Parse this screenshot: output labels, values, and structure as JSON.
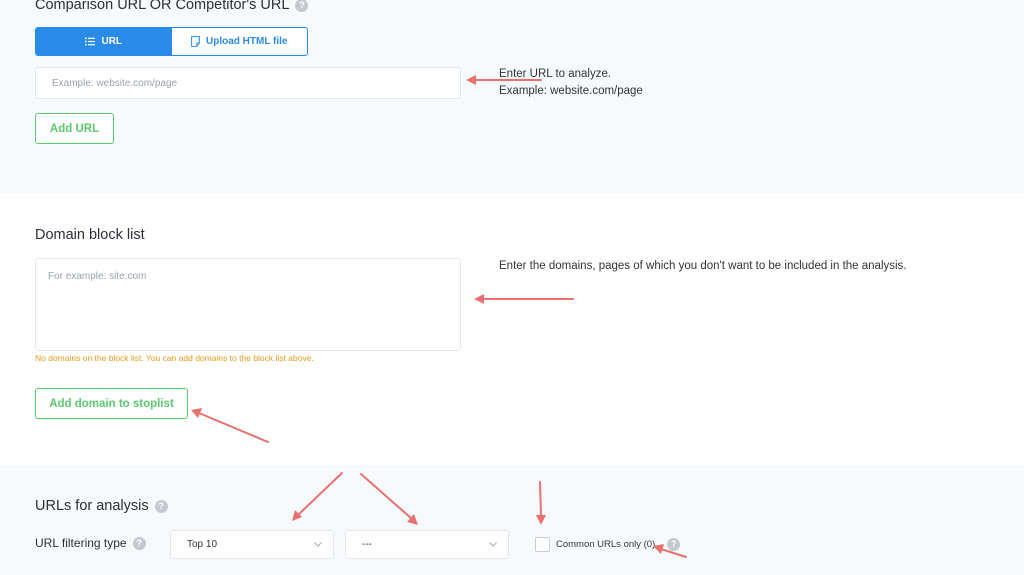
{
  "comparison": {
    "title": "Comparison URL OR Competitor's URL",
    "tabs": [
      {
        "label": "URL",
        "active": true,
        "icon": "list-icon"
      },
      {
        "label": "Upload HTML file",
        "active": false,
        "icon": "file-icon"
      }
    ],
    "url_placeholder": "Example: website.com/page",
    "add_button": "Add URL",
    "note_line1": "Enter URL to analyze.",
    "note_line2": "Example: website.com/page"
  },
  "blocklist": {
    "title": "Domain block list",
    "placeholder": "For example: site.com",
    "note": "Enter the domains, pages of which you don't want to be included in the analysis.",
    "warning": "No domains on the block list. You can add domains to the block list above.",
    "add_button": "Add domain to stoplist"
  },
  "analysis": {
    "title": "URLs for analysis",
    "filter_label": "URL filtering type",
    "filter_value": "Top 10",
    "second_value": "---",
    "checkbox_label": "Common URLs only (0)",
    "checkbox_checked": false
  },
  "colors": {
    "accent_blue": "#2a8ae8",
    "accent_green": "#5cc870",
    "warning_orange": "#e29a1c",
    "annotation_red": "#e8706f"
  }
}
